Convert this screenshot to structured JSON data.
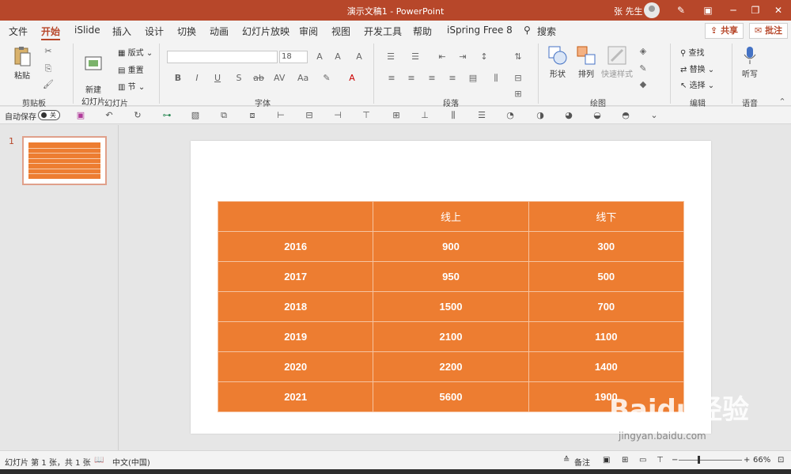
{
  "titlebar": {
    "doc_title": "演示文稿1  -  PowerPoint",
    "user": "张 先生"
  },
  "tabs": [
    {
      "label": "文件"
    },
    {
      "label": "开始"
    },
    {
      "label": "iSlide"
    },
    {
      "label": "插入"
    },
    {
      "label": "设计"
    },
    {
      "label": "切换"
    },
    {
      "label": "动画"
    },
    {
      "label": "幻灯片放映"
    },
    {
      "label": "审阅"
    },
    {
      "label": "视图"
    },
    {
      "label": "开发工具"
    },
    {
      "label": "帮助"
    },
    {
      "label": "iSpring Free 8"
    }
  ],
  "search": {
    "label": "搜索"
  },
  "share": {
    "label": "共享"
  },
  "comment": {
    "label": "批注"
  },
  "ribbon": {
    "clipboard": {
      "paste": "粘贴",
      "group": "剪贴板"
    },
    "slides": {
      "new_slide": "新建\n幻灯片",
      "layout": "版式",
      "reset": "重置",
      "section": "节",
      "group": "幻灯片"
    },
    "font": {
      "size": "18",
      "group": "字体"
    },
    "paragraph": {
      "group": "段落"
    },
    "drawing": {
      "shapes": "形状",
      "arrange": "排列",
      "quick_styles": "快速样式",
      "group": "绘图"
    },
    "editing": {
      "find": "查找",
      "replace": "替换",
      "select": "选择",
      "group": "编辑"
    },
    "voice": {
      "dictate": "听写",
      "group": "语音"
    }
  },
  "qat": {
    "autosave": "自动保存",
    "toggle": "关"
  },
  "thumbnail": {
    "number": "1"
  },
  "table": {
    "headers": [
      "",
      "线上",
      "线下"
    ],
    "rows": [
      [
        "2016",
        "900",
        "300"
      ],
      [
        "2017",
        "950",
        "500"
      ],
      [
        "2018",
        "1500",
        "700"
      ],
      [
        "2019",
        "2100",
        "1100"
      ],
      [
        "2020",
        "2200",
        "1400"
      ],
      [
        "2021",
        "5600",
        "1900"
      ]
    ]
  },
  "status": {
    "slide_info": "幻灯片 第 1 张，共 1 张",
    "language": "中文(中国)",
    "notes": "备注",
    "zoom": "66%"
  },
  "watermark": {
    "brand": "Baidu经验",
    "url": "jingyan.baidu.com"
  },
  "colors": {
    "accent": "#b7472a",
    "table_fill": "#ed7d31"
  }
}
